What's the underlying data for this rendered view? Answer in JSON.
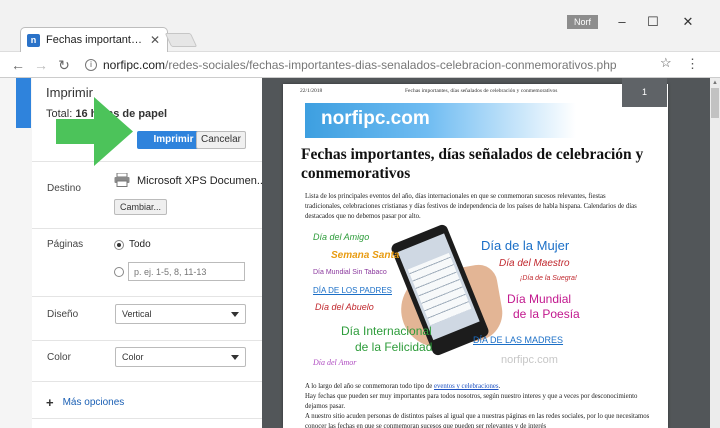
{
  "window": {
    "tab_title": "Fechas importantes, días",
    "favicon_letter": "n",
    "profile": "Norf"
  },
  "address": {
    "host": "norfipc.com",
    "path": "/redes-sociales/fechas-importantes-dias-senalados-celebracion-conmemorativos.php"
  },
  "print": {
    "title": "Imprimir",
    "total_label": "Total:",
    "total_value": "16 hojas de papel",
    "print_button": "Imprimir",
    "cancel_button": "Cancelar",
    "destination_label": "Destino",
    "printer_name": "Microsoft XPS Documen...",
    "change_button": "Cambiar...",
    "pages_label": "Páginas",
    "pages_all": "Todo",
    "pages_placeholder": "p. ej. 1-5, 8, 11-13",
    "layout_label": "Diseño",
    "layout_value": "Vertical",
    "color_label": "Color",
    "color_value": "Color",
    "more_options": "Más opciones"
  },
  "preview": {
    "page_number": "1",
    "header_date": "22/1/2018",
    "header_title": "Fechas importantes, días señalados de celebración y conmemorativos",
    "banner": "norfipc.com",
    "title": "Fechas importantes, días señalados de celebración y conmemorativos",
    "intro": "Lista de los principales eventos del año, días internacionales en que se conmemoran sucesos relevantes, fiestas tradicionales, celebraciones cristianas y días festivos de independencia de los países de habla hispana. Calendarios de días destacados que no debemos pasar por alto.",
    "collage": {
      "w1": "Día del Amigo",
      "w2": "Semana Santa",
      "w3": "Día de la Mujer",
      "w4": "Día del Maestro",
      "w5": "Día Mundial Sin Tabaco",
      "w6": "¡Día de la Suegra!",
      "w7": "DÍA DE LOS PADRES",
      "w8": "Día Mundial",
      "w9": "de la Poesía",
      "w10": "Día del Abuelo",
      "w11": "Día Internacional",
      "w12": "de la Felicidad",
      "w13": "DÍA DE LAS MADRES",
      "w14": "Día del Amor",
      "w15": "norfipc.com"
    },
    "para1_prefix": "A lo largo del año se conmemoran todo tipo de ",
    "para1_link": "eventos y celebraciones",
    "para1_suffix": ".",
    "para2": "Hay fechas que pueden ser muy importantes para todos nosotros, según nuestro interes y que a veces por desconocimiento dejamos pasar.",
    "para3": "A nuestro sitio acuden personas de distintos países al igual que a nuestras páginas en las redes sociales, por lo que necesitamos conocer las fechas en que se conmemoran sucesos que pueden ser relevantes y de interés"
  },
  "colors": {
    "accent": "#2f83dc",
    "arrow": "#4cc35a",
    "preview_bg": "#525659"
  }
}
